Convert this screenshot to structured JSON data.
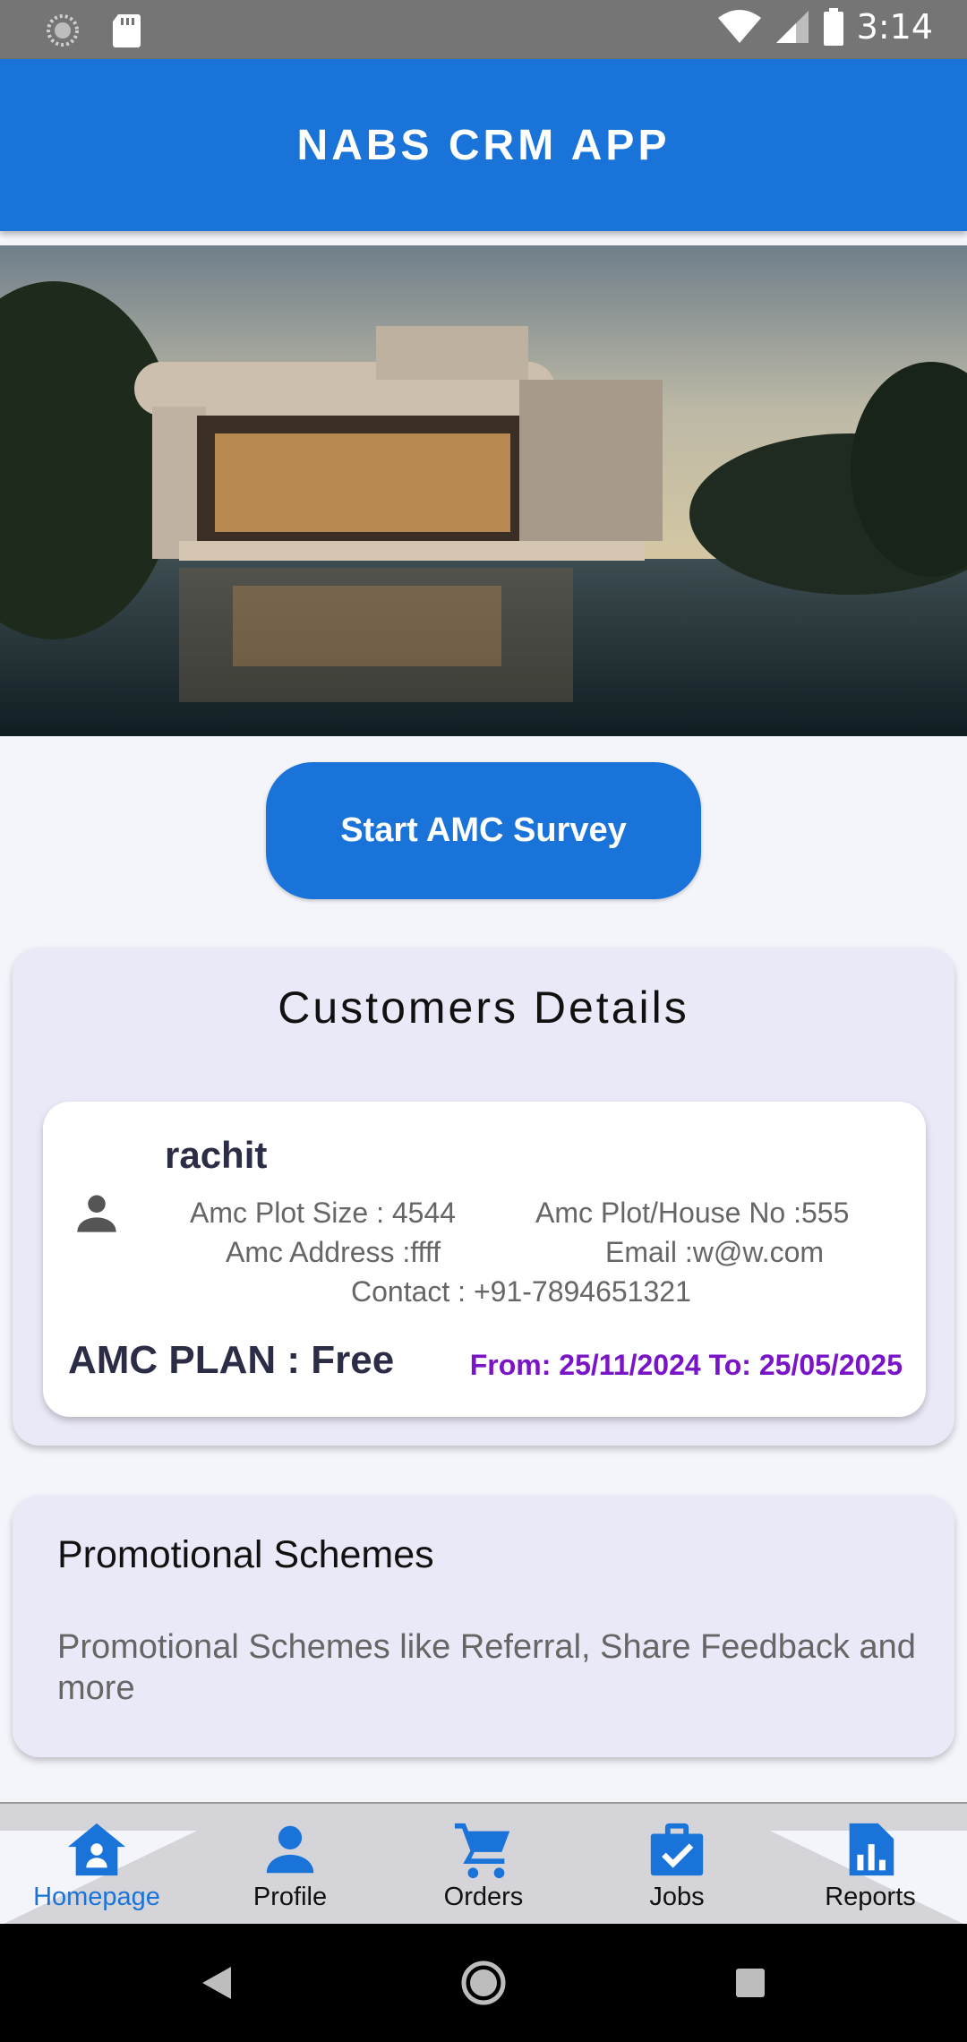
{
  "status_bar": {
    "time": "3:14",
    "icons": [
      "loading-icon",
      "sd-card-icon",
      "wifi-icon",
      "signal-icon",
      "battery-icon"
    ]
  },
  "app_bar": {
    "title": "NABS CRM APP"
  },
  "hero": {
    "description_icon": "house-photo"
  },
  "start_button": {
    "label": "Start AMC Survey"
  },
  "customers": {
    "title": "Customers Details",
    "customer": {
      "name": "rachit",
      "plot_size": "Amc Plot Size : 4544",
      "house_no": "Amc Plot/House No :555",
      "address": "Amc Address :ffff",
      "email": "Email :w@w.com",
      "contact": "Contact : +91-7894651321",
      "plan": "AMC PLAN : Free",
      "dates": "From: 25/11/2024 To: 25/05/2025"
    }
  },
  "promo": {
    "title": "Promotional Schemes",
    "description": "Promotional Schemes like Referral, Share Feedback and more"
  },
  "bottom_nav": {
    "items": [
      {
        "label": "Homepage",
        "icon": "home-icon",
        "active": true
      },
      {
        "label": "Profile",
        "icon": "person-icon",
        "active": false
      },
      {
        "label": "Orders",
        "icon": "cart-icon",
        "active": false
      },
      {
        "label": "Jobs",
        "icon": "briefcase-check-icon",
        "active": false
      },
      {
        "label": "Reports",
        "icon": "report-icon",
        "active": false
      }
    ]
  },
  "colors": {
    "primary": "#1a73d9",
    "card_bg": "#eae9f7",
    "date_purple": "#7a14c7",
    "status_bar": "#757575"
  }
}
